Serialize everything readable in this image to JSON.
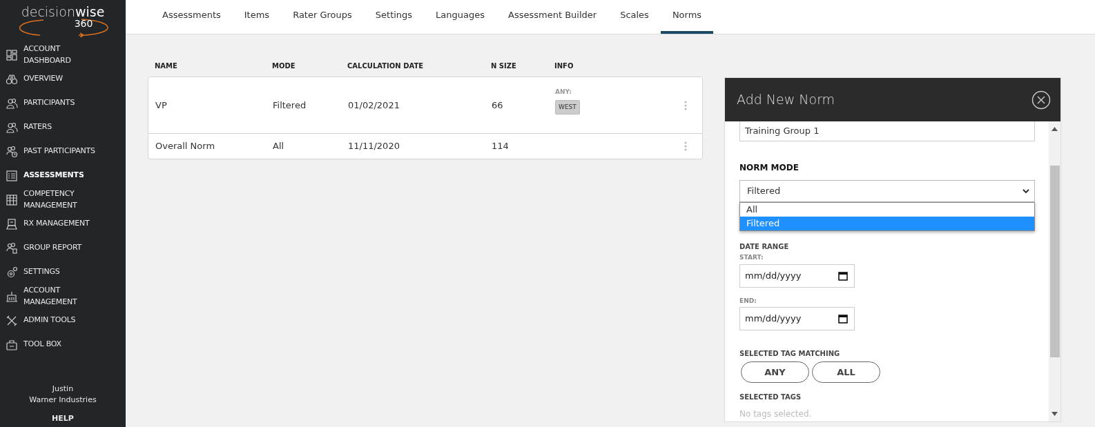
{
  "logo": {
    "wordmark": "decision**wise**",
    "suffix": "360"
  },
  "sidebar": {
    "items": [
      {
        "label": "ACCOUNT DASHBOARD",
        "selected": false
      },
      {
        "label": "OVERVIEW",
        "selected": false
      },
      {
        "label": "PARTICIPANTS",
        "selected": false
      },
      {
        "label": "RATERS",
        "selected": false
      },
      {
        "label": "PAST PARTICIPANTS",
        "selected": false
      },
      {
        "label": "ASSESSMENTS",
        "selected": true
      },
      {
        "label": "COMPETENCY MANAGEMENT",
        "selected": false
      },
      {
        "label": "RX MANAGEMENT",
        "selected": false
      },
      {
        "label": "GROUP REPORT",
        "selected": false
      },
      {
        "label": "SETTINGS",
        "selected": false
      },
      {
        "label": "ACCOUNT MANAGEMENT",
        "selected": false
      },
      {
        "label": "ADMIN TOOLS",
        "selected": false
      },
      {
        "label": "TOOL BOX",
        "selected": false
      }
    ],
    "user": {
      "name": "Justin",
      "company": "Warner Industries"
    },
    "help": "HELP"
  },
  "tabs": [
    {
      "label": "Assessments",
      "selected": false
    },
    {
      "label": "Items",
      "selected": false
    },
    {
      "label": "Rater Groups",
      "selected": false
    },
    {
      "label": "Settings",
      "selected": false
    },
    {
      "label": "Languages",
      "selected": false
    },
    {
      "label": "Assessment Builder",
      "selected": false
    },
    {
      "label": "Scales",
      "selected": false
    },
    {
      "label": "Norms",
      "selected": true
    }
  ],
  "table": {
    "columns": [
      "NAME",
      "MODE",
      "CALCULATION DATE",
      "N SIZE",
      "INFO"
    ],
    "rows": [
      {
        "name": "VP",
        "mode": "Filtered",
        "date": "01/02/2021",
        "n_size": "66",
        "info": {
          "matching": "ANY:",
          "tags": [
            "WEST"
          ]
        }
      },
      {
        "name": "Overall Norm",
        "mode": "All",
        "date": "11/11/2020",
        "n_size": "114"
      }
    ]
  },
  "panel": {
    "title": "Add New Norm",
    "name_field": {
      "value": "Training Group 1"
    },
    "norm_mode": {
      "label": "NORM MODE",
      "value": "Filtered",
      "options": [
        {
          "label": "All",
          "selected": false
        },
        {
          "label": "Filtered",
          "selected": true
        }
      ]
    },
    "date_range": {
      "label": "DATE RANGE",
      "start": {
        "label": "START:",
        "placeholder": "mm/dd/yyyy"
      },
      "end": {
        "label": "END:",
        "placeholder": "mm/dd/yyyy"
      }
    },
    "tag_matching": {
      "label": "SELECTED TAG MATCHING",
      "buttons": [
        "ANY",
        "ALL"
      ]
    },
    "selected_tags": {
      "label": "SELECTED TAGS",
      "empty_text": "No tags selected."
    }
  }
}
